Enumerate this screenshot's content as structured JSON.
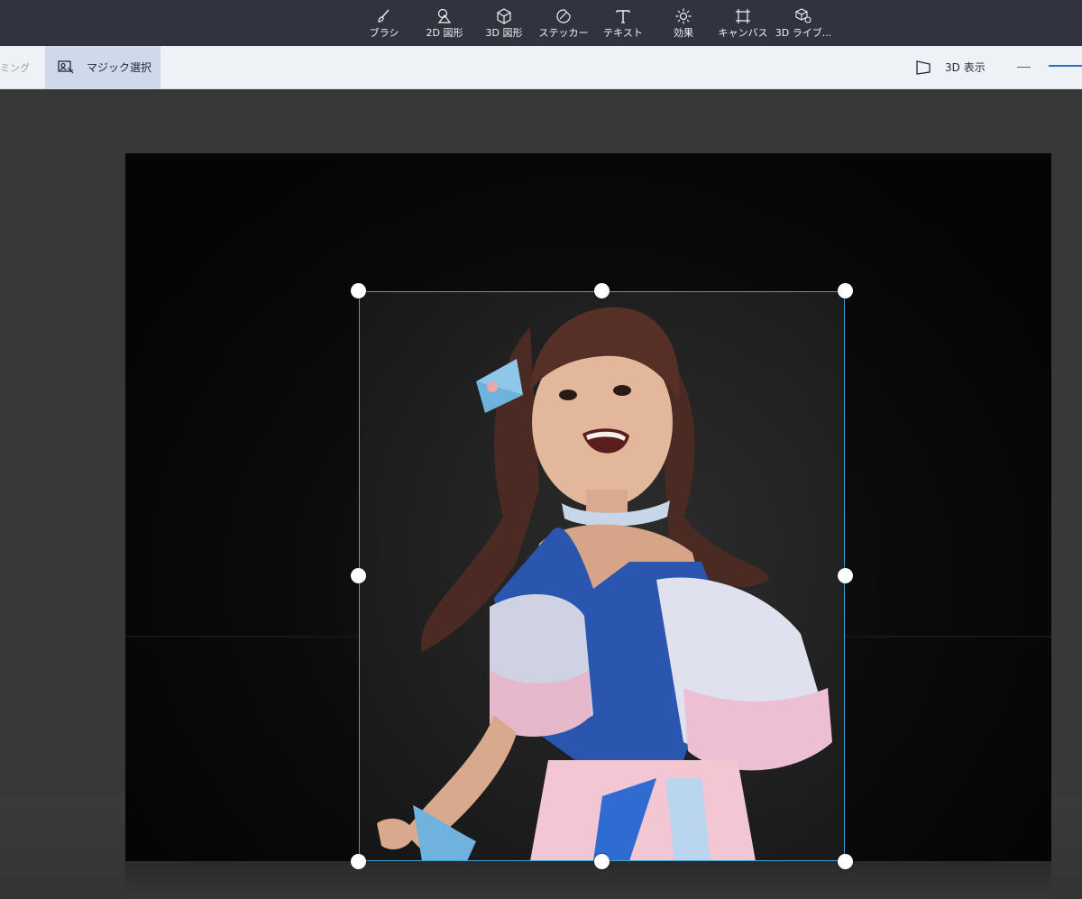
{
  "toolbar": {
    "tools": [
      {
        "label": "ブラシ",
        "icon": "brush-icon"
      },
      {
        "label": "2D 図形",
        "icon": "2d-shapes-icon"
      },
      {
        "label": "3D 図形",
        "icon": "3d-shapes-icon"
      },
      {
        "label": "ステッカー",
        "icon": "sticker-icon"
      },
      {
        "label": "テキスト",
        "icon": "text-icon"
      },
      {
        "label": "効果",
        "icon": "effects-icon"
      },
      {
        "label": "キャンバス",
        "icon": "canvas-icon"
      },
      {
        "label": "3D ライブ...",
        "icon": "3d-library-icon"
      }
    ]
  },
  "subbar": {
    "cut_label": "ミング",
    "magic_select_label": "マジック選択",
    "view_3d_label": "3D 表示"
  },
  "colors": {
    "topbar": "#2f343f",
    "subbar": "#eef1f5",
    "selection_border": "#3aa0d8",
    "workspace": "#383838"
  }
}
